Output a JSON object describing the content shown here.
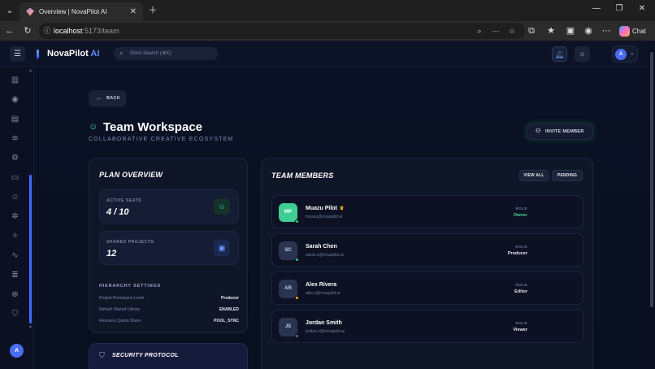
{
  "browser": {
    "tab_title": "Overview | NovaPilot AI",
    "url_host": "localhost",
    "url_path": ":5173/team",
    "chat_label": "Chat"
  },
  "topbar": {
    "brand_main": "NovaPilot",
    "brand_accent": "AI",
    "search_placeholder": "Omni Search (⌘K)",
    "user_initial": "A"
  },
  "sidebar": {
    "items": [
      "chart-icon",
      "eye-icon",
      "document-icon",
      "database-icon",
      "search-gear-icon",
      "file-icon",
      "users-icon",
      "settings-icon",
      "magic-wand-icon",
      "activity-icon",
      "layers-icon",
      "globe-icon",
      "shield-icon"
    ],
    "user_initial": "A"
  },
  "page": {
    "back_label": "BACK",
    "title": "Team Workspace",
    "subtitle": "COLLABORATIVE CREATIVE ECOSYSTEM",
    "invite_label": "INVITE MEMBER"
  },
  "plan": {
    "heading": "PLAN OVERVIEW",
    "active_seats_label": "ACTIVE SEATS",
    "active_seats_value": "4 / 10",
    "shared_projects_label": "SHARED PROJECTS",
    "shared_projects_value": "12",
    "hierarchy_heading": "HIERARCHY SETTINGS",
    "settings": [
      {
        "label": "Project Permission Level",
        "value": "Producer"
      },
      {
        "label": "Default Shared Library",
        "value": "ENABLED"
      },
      {
        "label": "Resource Quota Share",
        "value": "POOL_SYNC"
      }
    ]
  },
  "security": {
    "heading": "SECURITY PROTOCOL"
  },
  "team": {
    "heading": "TEAM MEMBERS",
    "view_all_label": "VIEW ALL",
    "pending_label": "PENDING",
    "role_label": "ROLE",
    "members": [
      {
        "initials": "MP",
        "name": "Muazu Pilot",
        "email": "muazu@novapilot.ai",
        "role": "Owner",
        "owner": true
      },
      {
        "initials": "SC",
        "name": "Sarah Chen",
        "email": "sarah.c@novapilot.ai",
        "role": "Producer",
        "owner": false
      },
      {
        "initials": "AR",
        "name": "Alex Rivera",
        "email": "alex.r@novapilot.ai",
        "role": "Editor",
        "owner": false
      },
      {
        "initials": "JS",
        "name": "Jordan Smith",
        "email": "jordan.s@novapilot.ai",
        "role": "Viewer",
        "owner": false
      }
    ]
  },
  "colors": {
    "accent": "#3f6bff",
    "success": "#44d18c",
    "owner_role": "#44d18c",
    "status_online": "#2ecc71",
    "status_away": "#f5b400",
    "status_offline": "#5d6b8c"
  }
}
